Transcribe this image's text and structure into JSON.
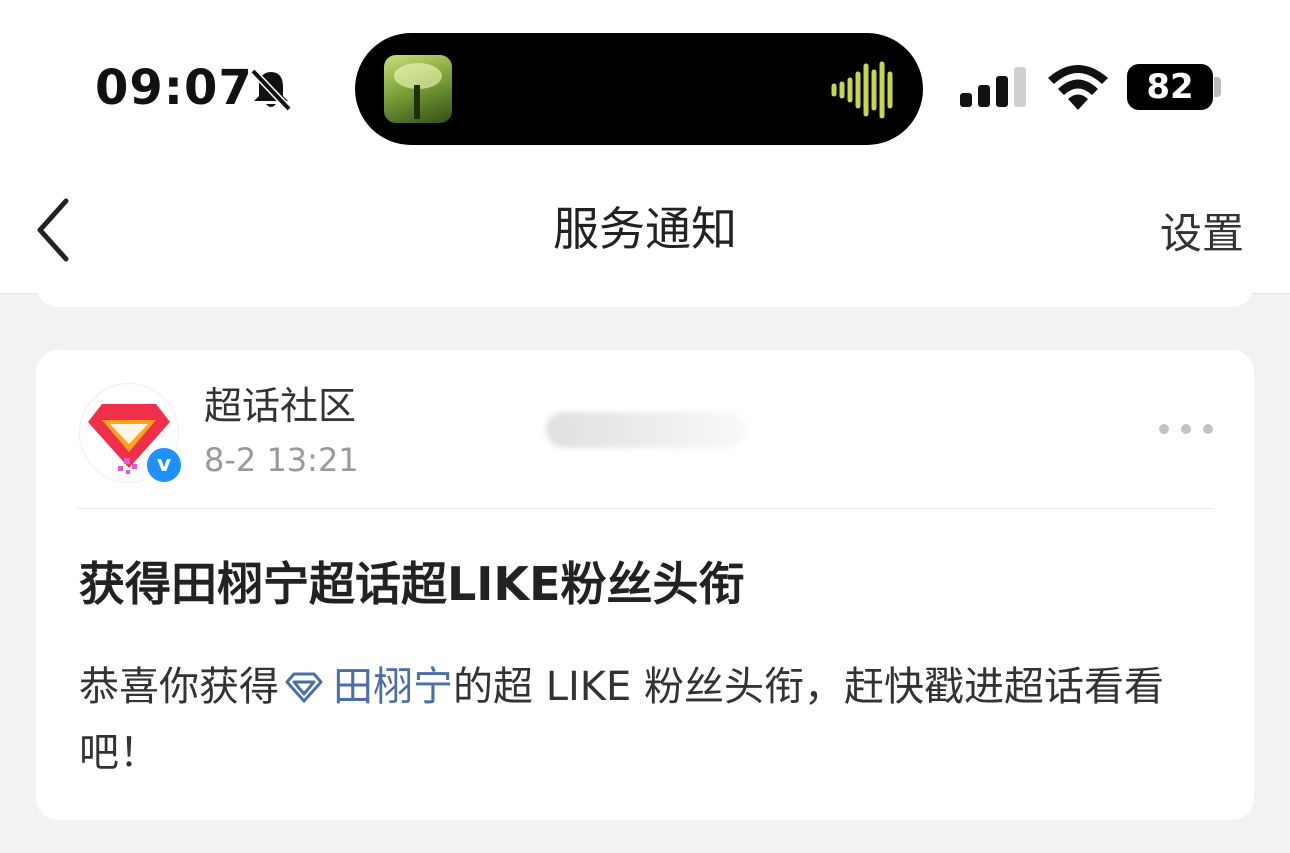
{
  "status_bar": {
    "time": "09:07",
    "battery": "82",
    "icons": [
      "bell-slash-icon",
      "audio-wave-icon",
      "signal-icon",
      "wifi-icon",
      "battery-icon"
    ]
  },
  "nav": {
    "back_icon": "chevron-left-icon",
    "title": "服务通知",
    "settings": "设置"
  },
  "notification": {
    "sender": "超话社区",
    "timestamp": "8-2 13:21",
    "more_icon": "more-dots-icon",
    "title": "获得田栩宁超话超LIKE粉丝头衔",
    "body": {
      "prefix": "恭喜你获得",
      "gem_icon": "diamond-icon",
      "link": "田栩宁",
      "suffix": "的超 LIKE 粉丝头衔，赶快戳进超话看看吧！"
    }
  },
  "colors": {
    "link": "#4a6ea9",
    "verify_badge": "#1e90ff",
    "brand_red": "#f0304a",
    "brand_orange": "#ffa41b"
  }
}
